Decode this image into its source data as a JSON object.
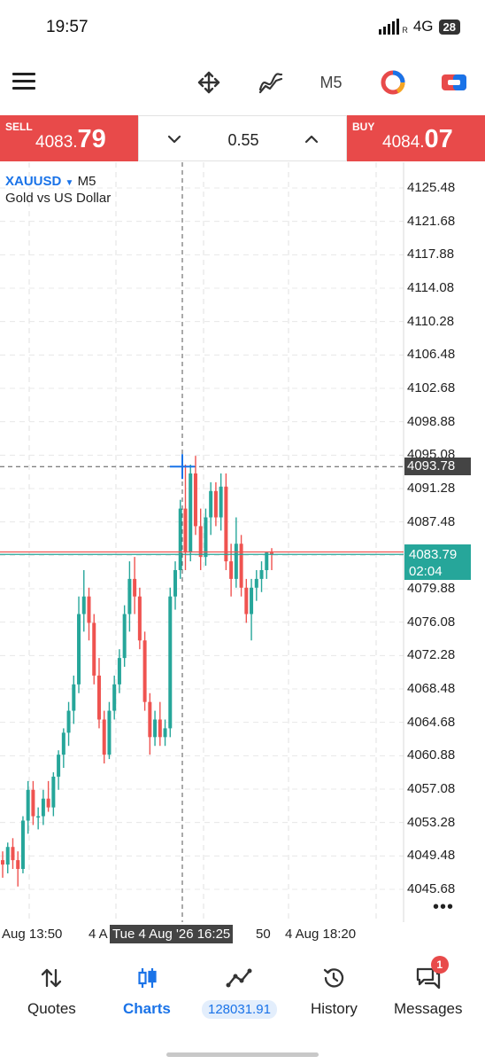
{
  "status_bar": {
    "time": "19:57",
    "network": "4G",
    "battery": "28"
  },
  "toolbar": {
    "timeframe": "M5"
  },
  "trade": {
    "sell_label": "SELL",
    "sell_small": "4083.",
    "sell_big": "79",
    "buy_label": "BUY",
    "buy_small": "4084.",
    "buy_big": "07",
    "lot": "0.55"
  },
  "chart": {
    "symbol": "XAUUSD",
    "timeframe": "M5",
    "description": "Gold vs US Dollar",
    "crosshair_price": "4093.78",
    "current_price": "4083.79",
    "countdown": "02:04",
    "crosshair_time": "Tue 4 Aug '26 16:25",
    "more": "•••",
    "x_labels": [
      {
        "text": "Aug 13:50"
      },
      {
        "text": "4 A"
      },
      {
        "text": "50"
      },
      {
        "text": "4 Aug 18:20"
      }
    ]
  },
  "chart_data": {
    "type": "candlestick",
    "symbol": "XAUUSD",
    "timeframe": "M5",
    "y_ticks": [
      "4125.48",
      "4121.68",
      "4117.88",
      "4114.08",
      "4110.28",
      "4106.48",
      "4102.68",
      "4098.88",
      "4095.08",
      "4091.28",
      "4087.48",
      "4083.68",
      "4079.88",
      "4076.08",
      "4072.28",
      "4068.48",
      "4064.68",
      "4060.88",
      "4057.08",
      "4053.28",
      "4049.48",
      "4045.68"
    ],
    "ylim": [
      4045.68,
      4125.48
    ],
    "x_ticks": [
      "Aug 13:50",
      "4 Aug",
      "4 Aug 18:20"
    ],
    "bid_line": 4083.79,
    "ask_line": 4084.07,
    "crosshair": {
      "price": 4093.78,
      "time": "Tue 4 Aug '26 16:25"
    },
    "up_color": "#26a69a",
    "down_color": "#ef5350",
    "candles": [
      [
        4049.0,
        4050.0,
        4047.0,
        4048.5
      ],
      [
        4048.5,
        4051.0,
        4047.5,
        4050.5
      ],
      [
        4050.5,
        4051.5,
        4048.0,
        4049.0
      ],
      [
        4049.0,
        4050.0,
        4046.0,
        4048.0
      ],
      [
        4048.0,
        4054.0,
        4047.5,
        4053.5
      ],
      [
        4053.5,
        4058.0,
        4052.0,
        4057.0
      ],
      [
        4057.0,
        4058.0,
        4053.0,
        4054.0
      ],
      [
        4054.0,
        4055.0,
        4052.5,
        4054.0
      ],
      [
        4054.0,
        4057.0,
        4053.0,
        4056.0
      ],
      [
        4056.0,
        4058.0,
        4054.5,
        4055.0
      ],
      [
        4055.0,
        4059.0,
        4054.0,
        4058.5
      ],
      [
        4058.5,
        4061.5,
        4057.0,
        4061.0
      ],
      [
        4061.0,
        4064.0,
        4059.5,
        4063.5
      ],
      [
        4063.5,
        4067.0,
        4062.0,
        4066.0
      ],
      [
        4066.0,
        4070.0,
        4064.5,
        4069.0
      ],
      [
        4069.0,
        4079.0,
        4068.0,
        4077.0
      ],
      [
        4077.0,
        4082.0,
        4075.0,
        4079.0
      ],
      [
        4079.0,
        4080.0,
        4074.0,
        4076.0
      ],
      [
        4076.0,
        4077.0,
        4069.0,
        4070.0
      ],
      [
        4070.0,
        4072.0,
        4064.0,
        4065.0
      ],
      [
        4065.0,
        4066.0,
        4060.0,
        4061.0
      ],
      [
        4061.0,
        4067.0,
        4060.5,
        4066.0
      ],
      [
        4066.0,
        4070.0,
        4065.0,
        4069.0
      ],
      [
        4069.0,
        4073.0,
        4068.0,
        4072.0
      ],
      [
        4072.0,
        4078.0,
        4071.0,
        4077.0
      ],
      [
        4077.0,
        4083.0,
        4075.0,
        4081.0
      ],
      [
        4081.0,
        4083.5,
        4077.0,
        4079.0
      ],
      [
        4079.0,
        4080.0,
        4073.0,
        4074.0
      ],
      [
        4074.0,
        4075.0,
        4066.0,
        4067.0
      ],
      [
        4067.0,
        4068.0,
        4061.0,
        4063.0
      ],
      [
        4063.0,
        4066.0,
        4062.0,
        4065.0
      ],
      [
        4065.0,
        4067.0,
        4062.0,
        4063.0
      ],
      [
        4063.0,
        4065.0,
        4062.0,
        4064.0
      ],
      [
        4064.0,
        4080.0,
        4063.0,
        4079.0
      ],
      [
        4079.0,
        4083.0,
        4077.5,
        4082.0
      ],
      [
        4082.0,
        4090.0,
        4081.0,
        4089.0
      ],
      [
        4089.0,
        4094.0,
        4082.0,
        4084.0
      ],
      [
        4084.0,
        4094.0,
        4083.0,
        4093.0
      ],
      [
        4093.0,
        4095.0,
        4086.0,
        4087.0
      ],
      [
        4087.0,
        4089.0,
        4082.0,
        4083.5
      ],
      [
        4083.5,
        4089.0,
        4082.5,
        4088.0
      ],
      [
        4088.0,
        4092.0,
        4086.0,
        4091.0
      ],
      [
        4091.0,
        4092.0,
        4087.0,
        4088.0
      ],
      [
        4088.0,
        4093.0,
        4086.5,
        4091.5
      ],
      [
        4091.5,
        4093.0,
        4082.0,
        4083.0
      ],
      [
        4083.0,
        4085.0,
        4079.0,
        4081.0
      ],
      [
        4081.0,
        4088.0,
        4080.0,
        4085.0
      ],
      [
        4085.0,
        4086.0,
        4079.0,
        4080.0
      ],
      [
        4080.0,
        4081.0,
        4076.0,
        4077.0
      ],
      [
        4077.0,
        4081.0,
        4074.0,
        4080.0
      ],
      [
        4080.0,
        4082.0,
        4078.5,
        4081.0
      ],
      [
        4081.0,
        4083.0,
        4079.5,
        4082.0
      ],
      [
        4082.0,
        4084.0,
        4081.0,
        4084.0
      ],
      [
        4084.0,
        4084.5,
        4082.0,
        4083.79
      ]
    ]
  }
}
